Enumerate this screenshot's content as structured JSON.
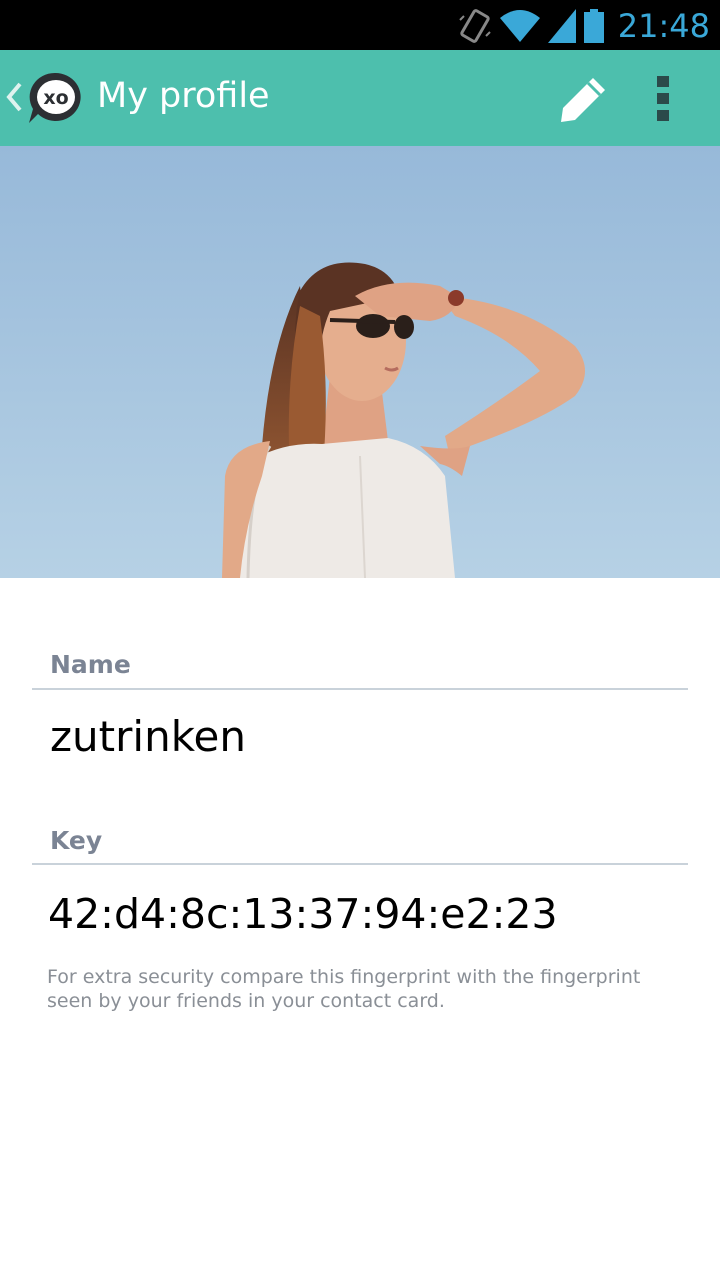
{
  "status_bar": {
    "time": "21:48"
  },
  "app_bar": {
    "title": "My profile"
  },
  "profile": {
    "name_label": "Name",
    "name_value": "zutrinken",
    "key_label": "Key",
    "key_value": "42:d4:8c:13:37:94:e2:23",
    "key_hint": "For extra security compare this fingerprint with the fingerprint seen by your friends in your contact card."
  },
  "colors": {
    "accent": "#4dbfad",
    "status_bar": "#000000",
    "clock": "#3aa8d8",
    "label": "#7b8494"
  }
}
